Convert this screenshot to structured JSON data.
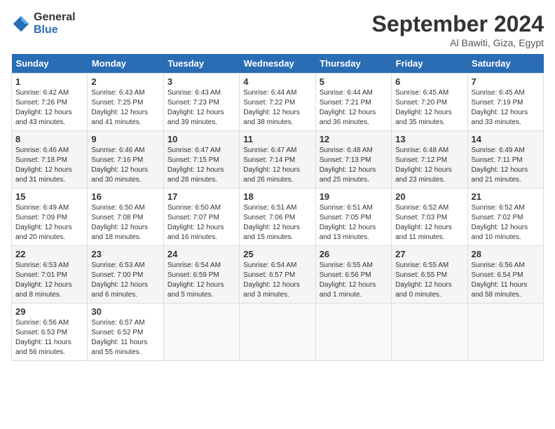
{
  "logo": {
    "general": "General",
    "blue": "Blue"
  },
  "header": {
    "month": "September 2024",
    "location": "Al Bawiti, Giza, Egypt"
  },
  "days": [
    "Sunday",
    "Monday",
    "Tuesday",
    "Wednesday",
    "Thursday",
    "Friday",
    "Saturday"
  ],
  "weeks": [
    [
      {
        "num": "1",
        "sunrise": "6:42 AM",
        "sunset": "7:26 PM",
        "daylight": "12 hours and 43 minutes."
      },
      {
        "num": "2",
        "sunrise": "6:43 AM",
        "sunset": "7:25 PM",
        "daylight": "12 hours and 41 minutes."
      },
      {
        "num": "3",
        "sunrise": "6:43 AM",
        "sunset": "7:23 PM",
        "daylight": "12 hours and 39 minutes."
      },
      {
        "num": "4",
        "sunrise": "6:44 AM",
        "sunset": "7:22 PM",
        "daylight": "12 hours and 38 minutes."
      },
      {
        "num": "5",
        "sunrise": "6:44 AM",
        "sunset": "7:21 PM",
        "daylight": "12 hours and 36 minutes."
      },
      {
        "num": "6",
        "sunrise": "6:45 AM",
        "sunset": "7:20 PM",
        "daylight": "12 hours and 35 minutes."
      },
      {
        "num": "7",
        "sunrise": "6:45 AM",
        "sunset": "7:19 PM",
        "daylight": "12 hours and 33 minutes."
      }
    ],
    [
      {
        "num": "8",
        "sunrise": "6:46 AM",
        "sunset": "7:18 PM",
        "daylight": "12 hours and 31 minutes."
      },
      {
        "num": "9",
        "sunrise": "6:46 AM",
        "sunset": "7:16 PM",
        "daylight": "12 hours and 30 minutes."
      },
      {
        "num": "10",
        "sunrise": "6:47 AM",
        "sunset": "7:15 PM",
        "daylight": "12 hours and 28 minutes."
      },
      {
        "num": "11",
        "sunrise": "6:47 AM",
        "sunset": "7:14 PM",
        "daylight": "12 hours and 26 minutes."
      },
      {
        "num": "12",
        "sunrise": "6:48 AM",
        "sunset": "7:13 PM",
        "daylight": "12 hours and 25 minutes."
      },
      {
        "num": "13",
        "sunrise": "6:48 AM",
        "sunset": "7:12 PM",
        "daylight": "12 hours and 23 minutes."
      },
      {
        "num": "14",
        "sunrise": "6:49 AM",
        "sunset": "7:11 PM",
        "daylight": "12 hours and 21 minutes."
      }
    ],
    [
      {
        "num": "15",
        "sunrise": "6:49 AM",
        "sunset": "7:09 PM",
        "daylight": "12 hours and 20 minutes."
      },
      {
        "num": "16",
        "sunrise": "6:50 AM",
        "sunset": "7:08 PM",
        "daylight": "12 hours and 18 minutes."
      },
      {
        "num": "17",
        "sunrise": "6:50 AM",
        "sunset": "7:07 PM",
        "daylight": "12 hours and 16 minutes."
      },
      {
        "num": "18",
        "sunrise": "6:51 AM",
        "sunset": "7:06 PM",
        "daylight": "12 hours and 15 minutes."
      },
      {
        "num": "19",
        "sunrise": "6:51 AM",
        "sunset": "7:05 PM",
        "daylight": "12 hours and 13 minutes."
      },
      {
        "num": "20",
        "sunrise": "6:52 AM",
        "sunset": "7:03 PM",
        "daylight": "12 hours and 11 minutes."
      },
      {
        "num": "21",
        "sunrise": "6:52 AM",
        "sunset": "7:02 PM",
        "daylight": "12 hours and 10 minutes."
      }
    ],
    [
      {
        "num": "22",
        "sunrise": "6:53 AM",
        "sunset": "7:01 PM",
        "daylight": "12 hours and 8 minutes."
      },
      {
        "num": "23",
        "sunrise": "6:53 AM",
        "sunset": "7:00 PM",
        "daylight": "12 hours and 6 minutes."
      },
      {
        "num": "24",
        "sunrise": "6:54 AM",
        "sunset": "6:59 PM",
        "daylight": "12 hours and 5 minutes."
      },
      {
        "num": "25",
        "sunrise": "6:54 AM",
        "sunset": "6:57 PM",
        "daylight": "12 hours and 3 minutes."
      },
      {
        "num": "26",
        "sunrise": "6:55 AM",
        "sunset": "6:56 PM",
        "daylight": "12 hours and 1 minute."
      },
      {
        "num": "27",
        "sunrise": "6:55 AM",
        "sunset": "6:55 PM",
        "daylight": "12 hours and 0 minutes."
      },
      {
        "num": "28",
        "sunrise": "6:56 AM",
        "sunset": "6:54 PM",
        "daylight": "11 hours and 58 minutes."
      }
    ],
    [
      {
        "num": "29",
        "sunrise": "6:56 AM",
        "sunset": "6:53 PM",
        "daylight": "11 hours and 56 minutes."
      },
      {
        "num": "30",
        "sunrise": "6:57 AM",
        "sunset": "6:52 PM",
        "daylight": "11 hours and 55 minutes."
      },
      null,
      null,
      null,
      null,
      null
    ]
  ]
}
